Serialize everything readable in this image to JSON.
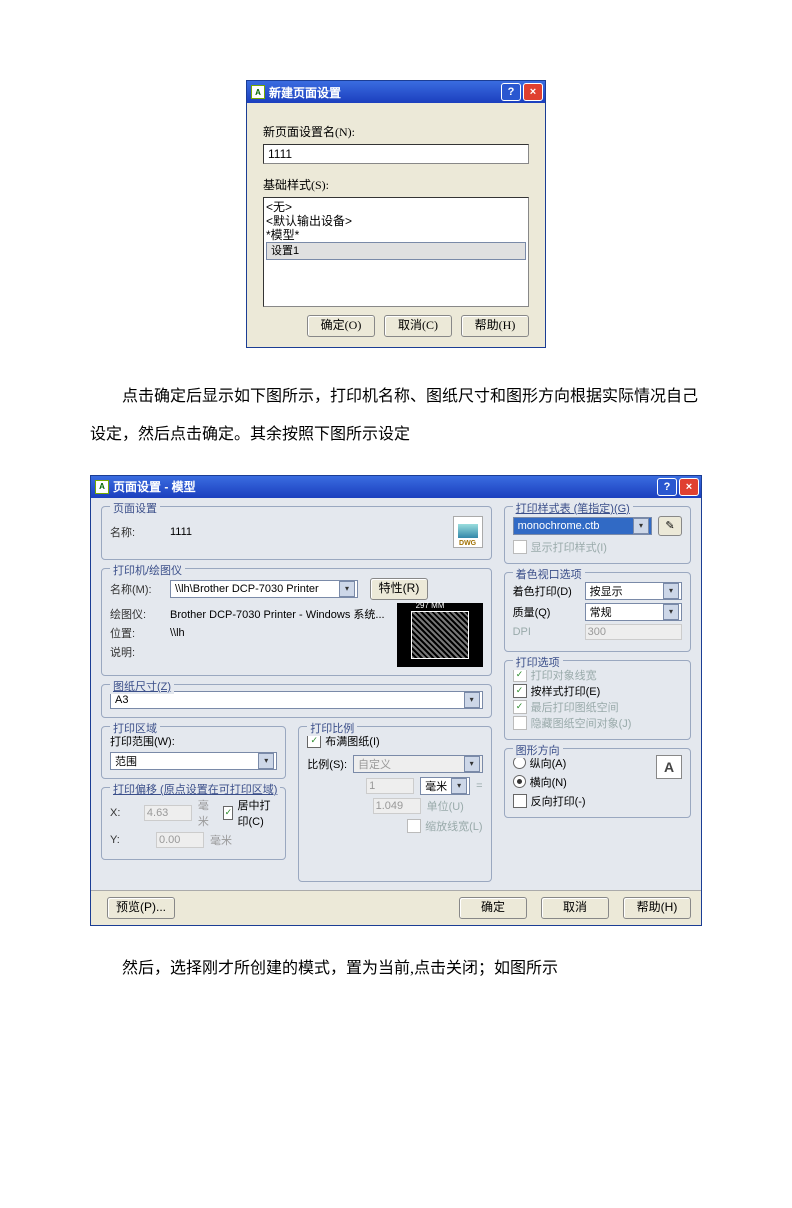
{
  "dlg1": {
    "title": "新建页面设置",
    "name_label": "新页面设置名(N):",
    "name_value": "1111",
    "base_label": "基础样式(S):",
    "list": [
      "<无>",
      "<默认输出设备>",
      "*模型*",
      "设置1"
    ],
    "ok": "确定(O)",
    "cancel": "取消(C)",
    "help": "帮助(H)"
  },
  "para1": "点击确定后显示如下图所示，打印机名称、图纸尺寸和图形方向根据实际情况自己设定，然后点击确定。其余按照下图所示设定",
  "dlg2": {
    "title": "页面设置 - 模型",
    "page_setup": {
      "group": "页面设置",
      "name_lbl": "名称:",
      "name_val": "1111",
      "dwg": "DWG"
    },
    "printer": {
      "group": "打印机/绘图仪",
      "name_lbl": "名称(M):",
      "name_val": "\\\\lh\\Brother DCP-7030 Printer",
      "props": "特性(R)",
      "plotter_lbl": "绘图仪:",
      "plotter_val": "Brother DCP-7030 Printer - Windows 系统...",
      "where_lbl": "位置:",
      "where_val": "\\\\lh",
      "desc_lbl": "说明:",
      "preview_dim": "297 MM"
    },
    "paper": {
      "group": "图纸尺寸(Z)",
      "value": "A3"
    },
    "area": {
      "group": "打印区域",
      "range_lbl": "打印范围(W):",
      "range_val": "范围"
    },
    "offset": {
      "group": "打印偏移 (原点设置在可打印区域)",
      "x_lbl": "X:",
      "x_val": "4.63",
      "y_lbl": "Y:",
      "y_val": "0.00",
      "unit": "毫米",
      "center": "居中打印(C)"
    },
    "scale": {
      "group": "打印比例",
      "fit": "布满图纸(I)",
      "scale_lbl": "比例(S):",
      "scale_val": "自定义",
      "num": "1",
      "num_unit": "毫米",
      "den": "1.049",
      "den_unit": "单位(U)",
      "scale_lw": "缩放线宽(L)"
    },
    "styles": {
      "group": "打印样式表 (笔指定)(G)",
      "value": "monochrome.ctb",
      "show": "显示打印样式(I)"
    },
    "viewport": {
      "group": "着色视口选项",
      "shade_lbl": "着色打印(D)",
      "shade_val": "按显示",
      "qual_lbl": "质量(Q)",
      "qual_val": "常规",
      "dpi_lbl": "DPI",
      "dpi_val": "300"
    },
    "options": {
      "group": "打印选项",
      "o1": "打印对象线宽",
      "o2": "按样式打印(E)",
      "o3": "最后打印图纸空间",
      "o4": "隐藏图纸空间对象(J)"
    },
    "orient": {
      "group": "图形方向",
      "portrait": "纵向(A)",
      "landscape": "横向(N)",
      "reverse": "反向打印(-)"
    },
    "bottom": {
      "preview": "预览(P)...",
      "ok": "确定",
      "cancel": "取消",
      "help": "帮助(H)"
    }
  },
  "para2": "然后，选择刚才所创建的模式，置为当前,点击关闭；如图所示"
}
